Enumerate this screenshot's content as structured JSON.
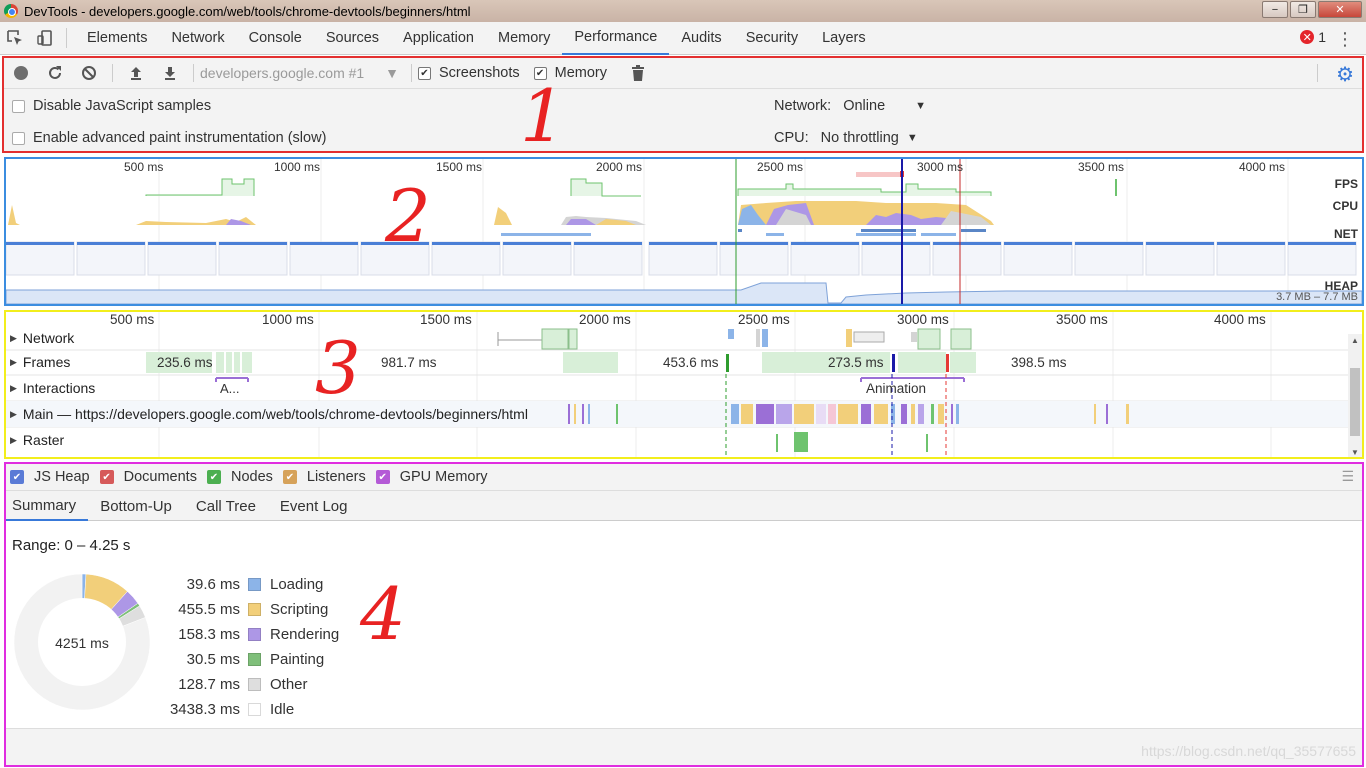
{
  "window": {
    "title": "DevTools - developers.google.com/web/tools/chrome-devtools/beginners/html",
    "minimize": "−",
    "maximize": "❐",
    "close": "✕"
  },
  "tabs": [
    "Elements",
    "Network",
    "Console",
    "Sources",
    "Application",
    "Memory",
    "Performance",
    "Audits",
    "Security",
    "Layers"
  ],
  "active_tab": "Performance",
  "error_count": "1",
  "toolbar": {
    "target": "developers.google.com #1",
    "screenshots_label": "Screenshots",
    "memory_label": "Memory",
    "screenshots_checked": true,
    "memory_checked": true
  },
  "options": {
    "disable_js_samples": "Disable JavaScript samples",
    "advanced_paint": "Enable advanced paint instrumentation (slow)",
    "network_label": "Network:",
    "network_value": "Online",
    "cpu_label": "CPU:",
    "cpu_value": "No throttling"
  },
  "overview": {
    "ticks": [
      "500 ms",
      "1000 ms",
      "1500 ms",
      "2000 ms",
      "2500 ms",
      "3000 ms",
      "3500 ms",
      "4000 ms"
    ],
    "fps_label": "FPS",
    "cpu_label": "CPU",
    "net_label": "NET",
    "heap_label": "HEAP",
    "heap_range": "3.7 MB – 7.7 MB"
  },
  "flame": {
    "ticks": [
      "500 ms",
      "1000 ms",
      "1500 ms",
      "2000 ms",
      "2500 ms",
      "3000 ms",
      "3500 ms",
      "4000 ms"
    ],
    "tracks": [
      "Network",
      "Frames",
      "Interactions",
      "Main — https://developers.google.com/web/tools/chrome-devtools/beginners/html",
      "Raster"
    ],
    "frame_times": [
      "235.6 ms",
      "981.7 ms",
      "453.6 ms",
      "273.5 ms",
      "398.5 ms"
    ],
    "interaction_short": "A...",
    "interaction_animation": "Animation"
  },
  "counters": [
    {
      "label": "JS Heap",
      "color": "#5a7bd6"
    },
    {
      "label": "Documents",
      "color": "#d65a5a"
    },
    {
      "label": "Nodes",
      "color": "#4caf50"
    },
    {
      "label": "Listeners",
      "color": "#d6a25a"
    },
    {
      "label": "GPU Memory",
      "color": "#b45ad6"
    }
  ],
  "subtabs": [
    "Summary",
    "Bottom-Up",
    "Call Tree",
    "Event Log"
  ],
  "active_subtab": "Summary",
  "summary": {
    "range": "Range: 0 – 4.25 s",
    "total": "4251 ms",
    "items": [
      {
        "ms": "39.6 ms",
        "label": "Loading",
        "color": "#8cb4e8",
        "value": 39.6
      },
      {
        "ms": "455.5 ms",
        "label": "Scripting",
        "color": "#f2cf7a",
        "value": 455.5
      },
      {
        "ms": "158.3 ms",
        "label": "Rendering",
        "color": "#ad97e6",
        "value": 158.3
      },
      {
        "ms": "30.5 ms",
        "label": "Painting",
        "color": "#7fbf7a",
        "value": 30.5
      },
      {
        "ms": "128.7 ms",
        "label": "Other",
        "color": "#dedede",
        "value": 128.7
      },
      {
        "ms": "3438.3 ms",
        "label": "Idle",
        "color": "#ffffff",
        "value": 3438.3
      }
    ]
  },
  "watermark": "https://blog.csdn.net/qq_35577655",
  "annotations": [
    "1",
    "2",
    "3",
    "4"
  ]
}
